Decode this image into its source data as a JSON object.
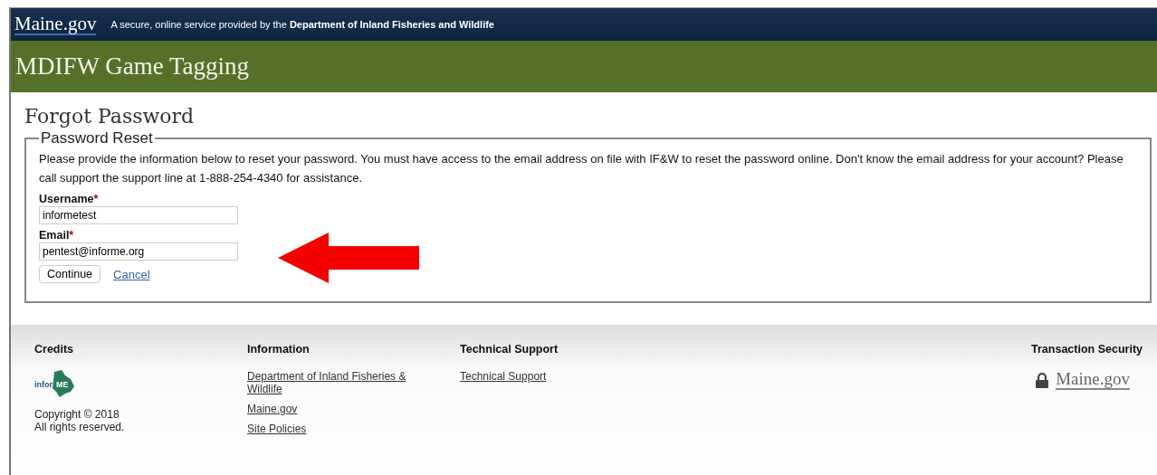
{
  "top_bar": {
    "logo": "Maine.gov",
    "tagline": "A secure, online service provided by the **Department of Inland Fisheries and Wildlife**"
  },
  "banner": {
    "title": "MDIFW Game Tagging"
  },
  "page_title": "Forgot Password",
  "form": {
    "legend": "Password Reset",
    "intro": "Please provide the information below to reset your password. You must have access to the email address on file with IF&W to reset the password online. Don't know the email address for your account? Please call support the support line at 1-888-254-4340 for assistance.",
    "fields": [
      {
        "label": "Username",
        "required_mark": "*",
        "value": "informetest"
      },
      {
        "label": "Email",
        "required_mark": "*",
        "value": "pentest@informe.org"
      }
    ],
    "submit": "Continue",
    "cancel": "Cancel"
  },
  "footer": {
    "columns": [
      {
        "kind": "credits",
        "heading": "Credits",
        "logo": [
          "infor",
          "ME"
        ],
        "lines": [
          "Copyright © 2018",
          "All rights reserved."
        ]
      },
      {
        "kind": "links",
        "heading": "Information",
        "links": [
          "Department of Inland Fisheries & Wildlife",
          "Maine.gov",
          "Site Policies"
        ]
      },
      {
        "kind": "links",
        "heading": "Technical Support",
        "links": [
          "Technical Support"
        ]
      },
      {
        "kind": "security",
        "heading": "Transaction Security",
        "logo": "Maine.gov"
      }
    ]
  }
}
